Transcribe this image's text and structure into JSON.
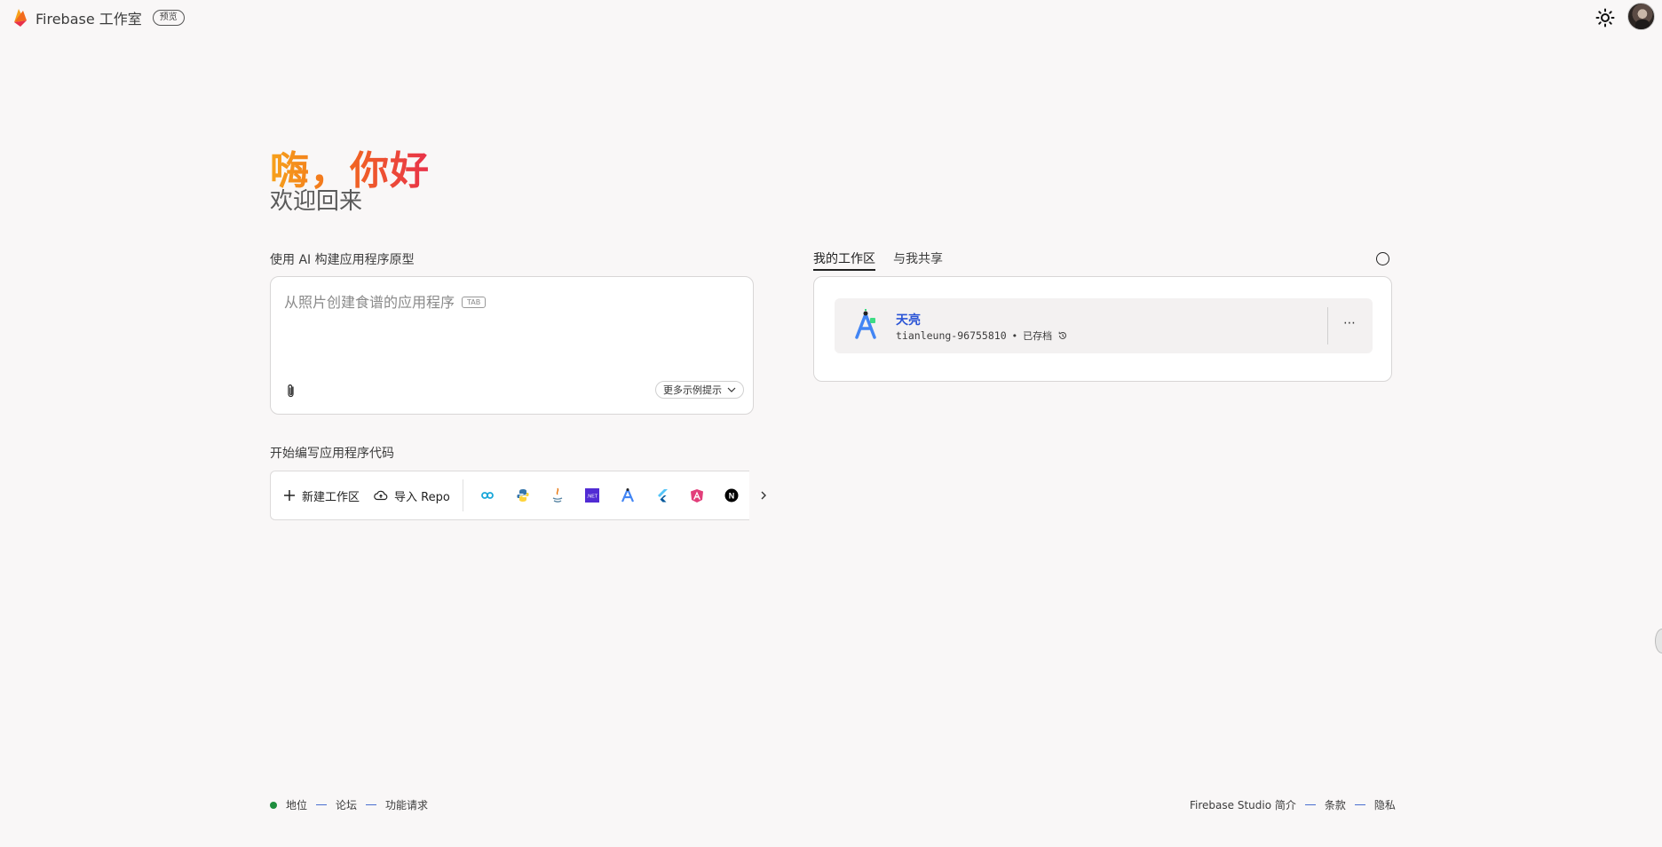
{
  "header": {
    "app_name": "Firebase 工作室",
    "preview_badge": "预览",
    "theme_icon": "sun-icon",
    "avatar_icon": "user-avatar"
  },
  "greeting": {
    "title": "嗨，你好",
    "subtitle": "欢迎回来"
  },
  "prototype": {
    "label": "使用 AI 构建应用程序原型",
    "placeholder": "从照片创建食谱的应用程序",
    "tab_hint": "TAB",
    "attach_icon": "paperclip-icon",
    "more_examples": "更多示例提示"
  },
  "code": {
    "label": "开始编写应用程序代码",
    "new_workspace": "新建工作区",
    "import_repo": "导入 Repo",
    "templates": [
      "go-icon",
      "python-icon",
      "java-icon",
      "dotnet-icon",
      "android-studio-icon",
      "flutter-icon",
      "angular-icon",
      "nextjs-icon"
    ],
    "dotnet_label": ".NET",
    "nextjs_label": "N"
  },
  "workspaces": {
    "tabs": [
      {
        "label": "我的工作区",
        "active": true
      },
      {
        "label": "与我共享",
        "active": false
      }
    ],
    "items": [
      {
        "name": "天亮",
        "id": "tianleung-96755810",
        "separator": "•",
        "status": "已存档",
        "more": "⋯"
      }
    ]
  },
  "footer": {
    "left": [
      "地位",
      "论坛",
      "功能请求"
    ],
    "right": [
      "Firebase Studio 简介",
      "条款",
      "隐私"
    ]
  },
  "colors": {
    "background": "#f9f7f7",
    "status_green": "#1e8e3e",
    "link_blue": "#2b55d6",
    "greeting_gradient": [
      "#f6a21c",
      "#e8314a"
    ]
  }
}
